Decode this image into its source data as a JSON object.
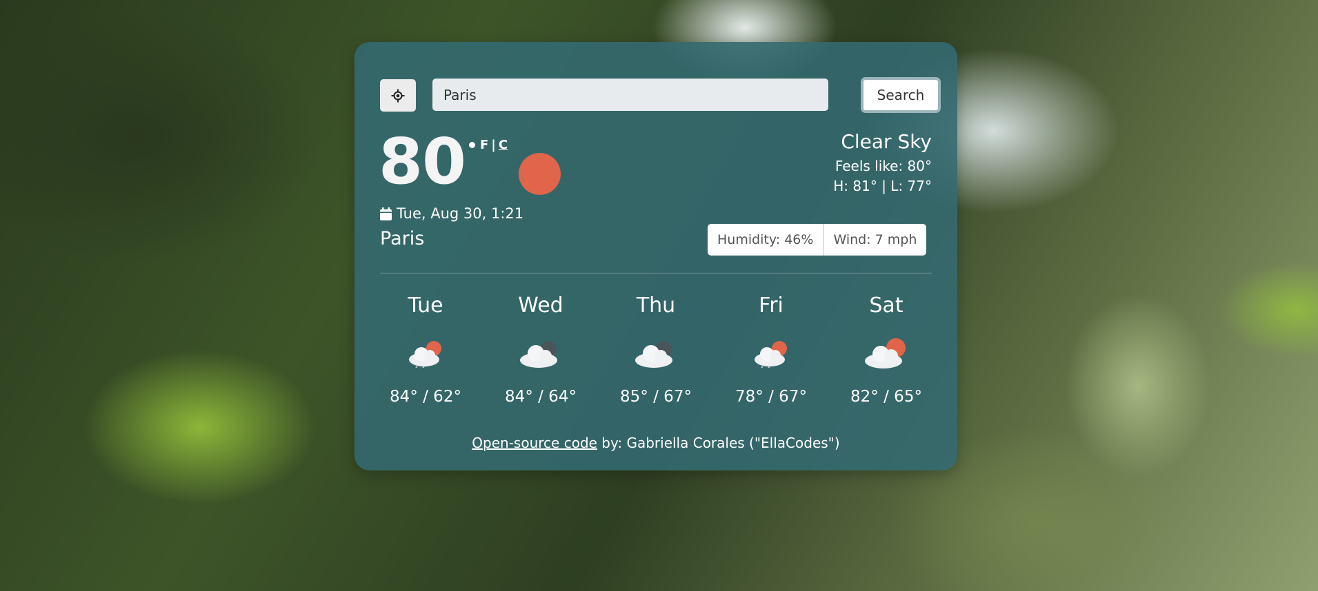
{
  "search": {
    "value": "Paris",
    "button_label": "Search"
  },
  "current": {
    "temp": "80",
    "unit_f": "F",
    "unit_sep": "|",
    "unit_c": "C",
    "date": "Tue, Aug 30, 1:21",
    "city": "Paris",
    "condition": "Clear Sky",
    "feels_like": "Feels like: 80°",
    "high_low": "H: 81° | L: 77°",
    "humidity": "Humidity: 46%",
    "wind": "Wind: 7 mph",
    "icon": "sun-icon"
  },
  "forecast": [
    {
      "day": "Tue",
      "temps": "84° / 62°",
      "icon": "partly-cloudy-icon"
    },
    {
      "day": "Wed",
      "temps": "84° / 64°",
      "icon": "cloudy-icon"
    },
    {
      "day": "Thu",
      "temps": "85° / 67°",
      "icon": "cloudy-icon"
    },
    {
      "day": "Fri",
      "temps": "78° / 67°",
      "icon": "partly-cloudy-icon"
    },
    {
      "day": "Sat",
      "temps": "82° / 65°",
      "icon": "partly-cloudy-icon"
    }
  ],
  "footer": {
    "link_text": "Open-source code",
    "suffix": " by: Gabriella Corales (\"EllaCodes\")"
  },
  "colors": {
    "card_background": "#346970",
    "sun": "#e0654a"
  }
}
